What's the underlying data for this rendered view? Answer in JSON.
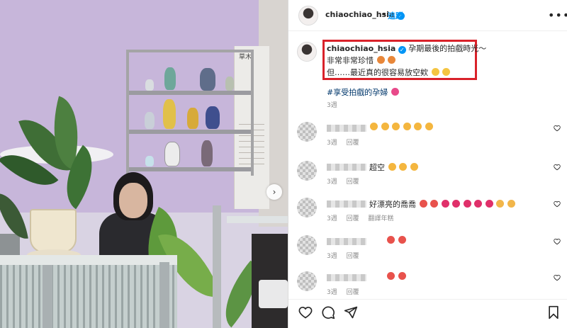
{
  "post": {
    "username": "chiaochiao_hsia",
    "verified_mark": "✓",
    "follow_label": "追蹤",
    "more_icon": "more-horizontal-icon"
  },
  "caption": {
    "username": "chiaochiao_hsia",
    "line1": "孕期最後的拍戲時光～",
    "line2": "非常非常珍惜",
    "line3": "但……最近真的很容易放空欸",
    "hashtag": "#享受拍戲的孕婦",
    "time": "3週"
  },
  "comments": [
    {
      "text": "",
      "emoji_count": 6,
      "time": "3週",
      "reply": "回覆",
      "extra": ""
    },
    {
      "text": "超空",
      "emoji_count": 3,
      "time": "3週",
      "reply": "回覆",
      "extra": ""
    },
    {
      "text": "好漂亮的喬喬",
      "emoji_count": 9,
      "time": "3週",
      "reply": "回覆",
      "extra": "翻譯年糕"
    },
    {
      "text": "",
      "emoji_count": 2,
      "time": "3週",
      "reply": "回覆",
      "extra": ""
    },
    {
      "text": "",
      "emoji_count": 2,
      "time": "3週",
      "reply": "回覆",
      "extra": ""
    }
  ],
  "photo": {
    "board_text": "草木"
  },
  "colors": {
    "accent": "#0095f6",
    "highlight_box": "#d9222a",
    "hashtag": "#00376b"
  }
}
